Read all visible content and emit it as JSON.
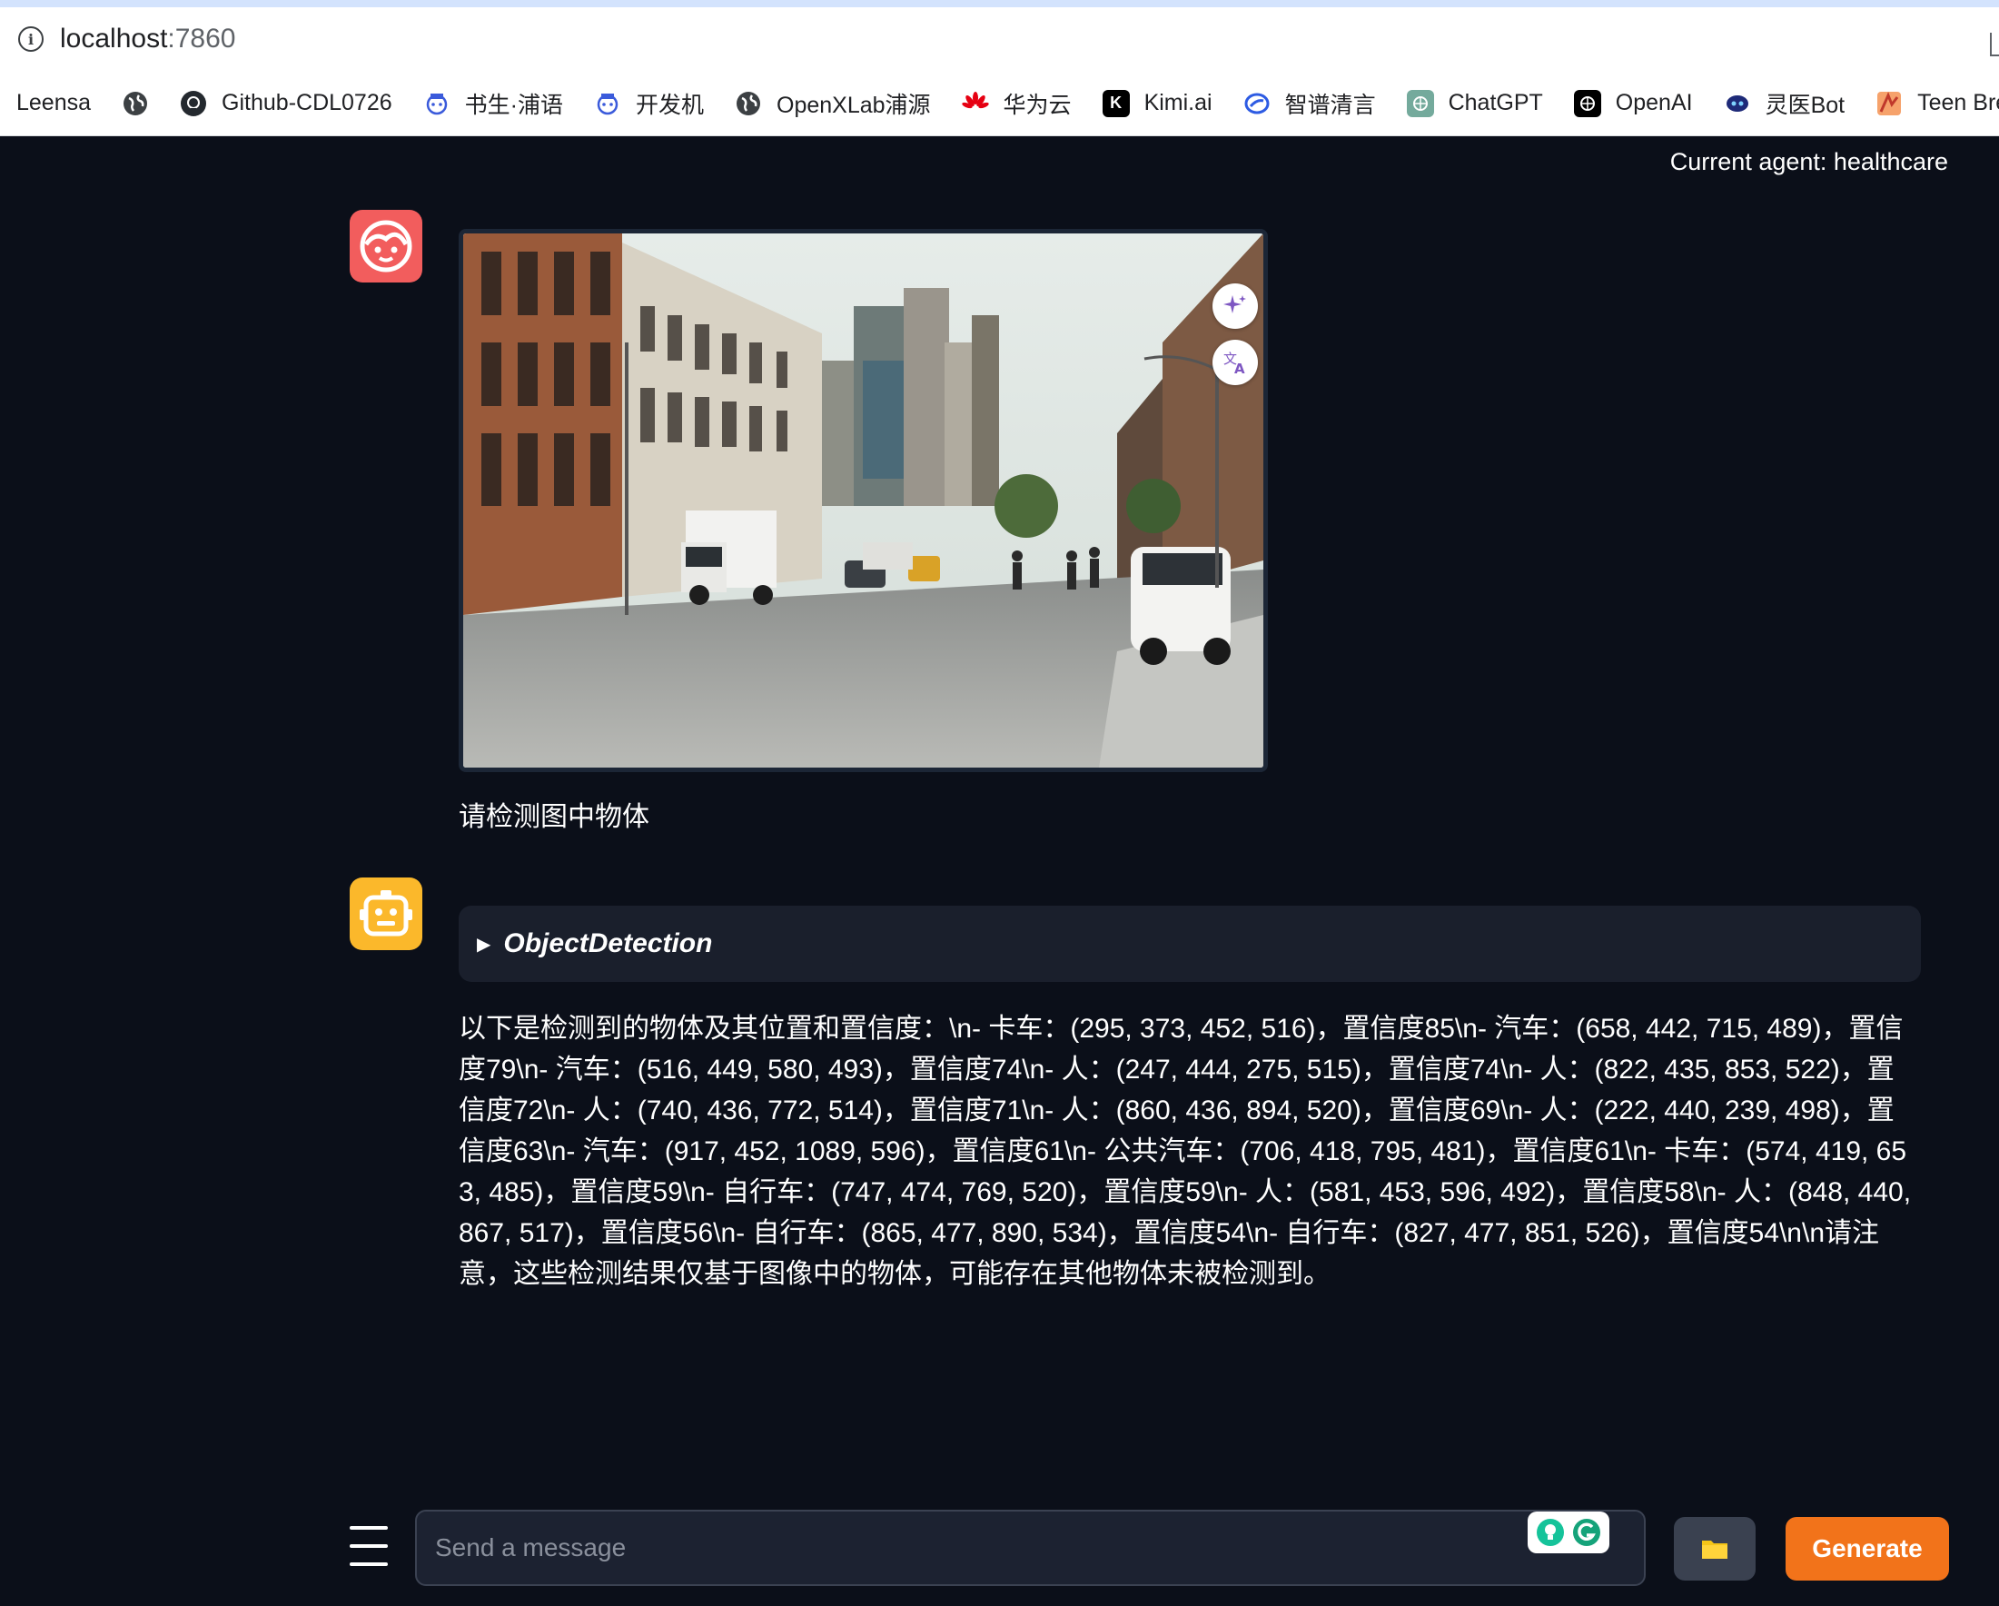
{
  "browser": {
    "url_host": "localhost",
    "url_port": ":7860",
    "bookmarks": [
      {
        "label": "Leensa",
        "icon": "none"
      },
      {
        "label": "",
        "icon": "globe-icon"
      },
      {
        "label": "Github-CDL0726",
        "icon": "github-icon"
      },
      {
        "label": "书生·浦语",
        "icon": "intern-icon"
      },
      {
        "label": "开发机",
        "icon": "intern-icon"
      },
      {
        "label": "OpenXLab浦源",
        "icon": "globe-icon"
      },
      {
        "label": "华为云",
        "icon": "huawei-icon"
      },
      {
        "label": "Kimi.ai",
        "icon": "kimi-icon"
      },
      {
        "label": "智谱清言",
        "icon": "zhipu-icon"
      },
      {
        "label": "ChatGPT",
        "icon": "chatgpt-icon"
      },
      {
        "label": "OpenAI",
        "icon": "openai-icon"
      },
      {
        "label": "灵医Bot",
        "icon": "bot-icon"
      },
      {
        "label": "Teen Brea",
        "icon": "teen-icon"
      }
    ]
  },
  "header": {
    "agent_label": "Current agent: healthcare"
  },
  "chat": {
    "user_message": "请检测图中物体",
    "tool_name": "ObjectDetection",
    "bot_message": "以下是检测到的物体及其位置和置信度：\\n- 卡车：(295, 373, 452, 516)，置信度85\\n- 汽车：(658, 442, 715, 489)，置信度79\\n- 汽车：(516, 449, 580, 493)，置信度74\\n- 人：(247, 444, 275, 515)，置信度74\\n- 人：(822, 435, 853, 522)，置信度72\\n- 人：(740, 436, 772, 514)，置信度71\\n- 人：(860, 436, 894, 520)，置信度69\\n- 人：(222, 440, 239, 498)，置信度63\\n- 汽车：(917, 452, 1089, 596)，置信度61\\n- 公共汽车：(706, 418, 795, 481)，置信度61\\n- 卡车：(574, 419, 653, 485)，置信度59\\n- 自行车：(747, 474, 769, 520)，置信度59\\n- 人：(581, 453, 596, 492)，置信度58\\n- 人：(848, 440, 867, 517)，置信度56\\n- 自行车：(865, 477, 890, 534)，置信度54\\n- 自行车：(827, 477, 851, 526)，置信度54\\n\\n请注意，这些检测结果仅基于图像中的物体，可能存在其他物体未被检测到。"
  },
  "input": {
    "placeholder": "Send a message",
    "generate_label": "Generate"
  },
  "colors": {
    "background": "#0b0f19",
    "user_avatar": "#f25d5d",
    "bot_avatar": "#fbb82b",
    "generate_button": "#f2731a",
    "accordion": "#1a1f2c"
  }
}
